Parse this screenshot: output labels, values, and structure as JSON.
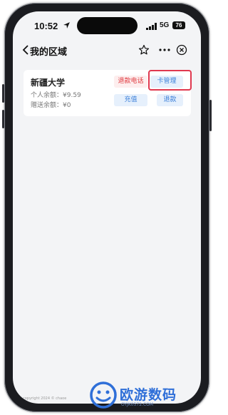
{
  "status_bar": {
    "time": "10:52",
    "network": "5G",
    "battery": "76"
  },
  "nav": {
    "title": "我的区域"
  },
  "card": {
    "school": "新疆大学",
    "personal_balance": "个人余额：¥9.59",
    "gift_balance": "赠送余额：¥0",
    "buttons": {
      "refund_phone": "退款电话",
      "card_manage": "卡管理",
      "recharge": "充值",
      "refund": "退款"
    }
  },
  "footer": {
    "copyright": "copyright 2024 © chaoe"
  },
  "watermark": {
    "brand": "欧游数码",
    "url": "OYJK0572.COM"
  },
  "colors": {
    "accent_blue": "#3b7fd9",
    "accent_red": "#e0383e",
    "highlight": "#e0384f"
  }
}
